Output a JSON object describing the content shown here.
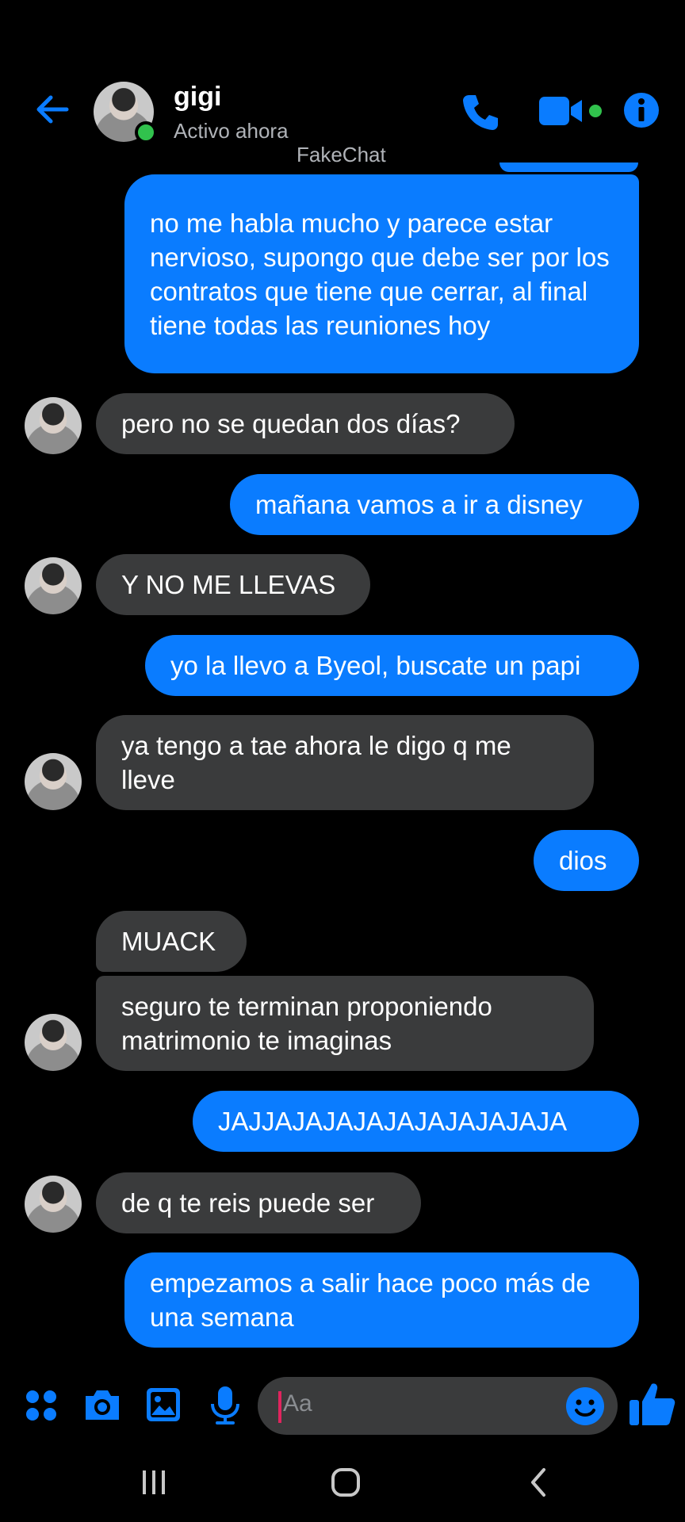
{
  "header": {
    "contact_name": "gigi",
    "status": "Activo ahora",
    "watermark": "FakeChat",
    "accent_color": "#0a7cff",
    "icons": [
      "back-arrow-icon",
      "phone-icon",
      "video-camera-icon",
      "info-icon"
    ]
  },
  "messages": [
    {
      "dir": "out",
      "text": "no me habla mucho y parece estar nervioso, supongo que debe ser por los contratos que tiene que cerrar, al final tiene todas las reuniones hoy"
    },
    {
      "dir": "in",
      "text": "pero no se quedan dos días?"
    },
    {
      "dir": "out",
      "text": "mañana vamos a ir a disney"
    },
    {
      "dir": "in",
      "text": "Y NO ME LLEVAS"
    },
    {
      "dir": "out",
      "text": "yo la llevo a Byeol, buscate un papi"
    },
    {
      "dir": "in",
      "text": "ya tengo a tae ahora le digo q me lleve"
    },
    {
      "dir": "out",
      "text": "dios"
    },
    {
      "dir": "in",
      "text": "MUACK"
    },
    {
      "dir": "in",
      "text": "seguro te terminan proponiendo matrimonio te imaginas"
    },
    {
      "dir": "out",
      "text": "JAJJAJAJAJAJAJAJAJAJAJA"
    },
    {
      "dir": "in",
      "text": "de q te reis puede ser"
    },
    {
      "dir": "out",
      "text": "empezamos a salir hace poco más de una semana"
    }
  ],
  "composer": {
    "placeholder": "Aa",
    "icons": [
      "apps-grid-icon",
      "camera-icon",
      "gallery-icon",
      "microphone-icon",
      "emoji-icon",
      "thumbs-up-icon"
    ]
  },
  "colors": {
    "outgoing": "#0a7cff",
    "incoming": "#3a3b3c",
    "online": "#31c24d"
  }
}
